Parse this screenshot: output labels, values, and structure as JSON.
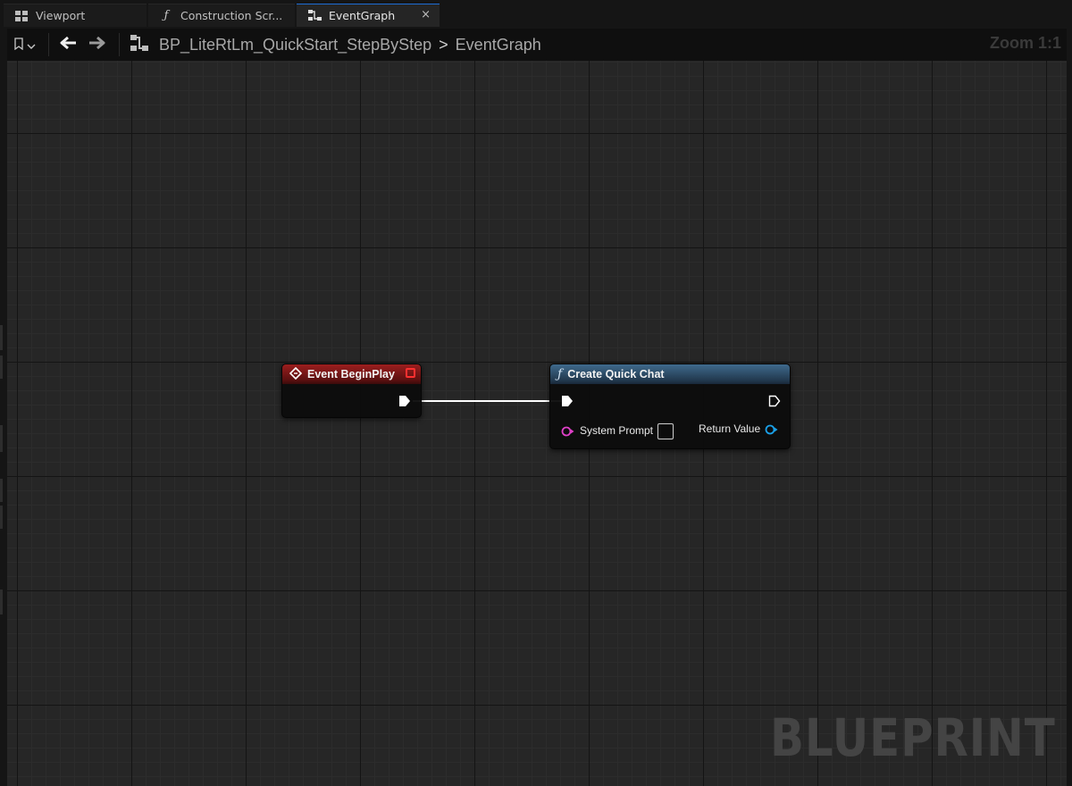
{
  "tabs": [
    {
      "label": "Viewport",
      "icon": "viewport-icon",
      "active": false
    },
    {
      "label": "Construction Scr...",
      "icon": "function-icon",
      "active": false
    },
    {
      "label": "EventGraph",
      "icon": "graph-icon",
      "active": true
    }
  ],
  "close_glyph": "×",
  "toolbar": {
    "blueprint_name": "BP_LiteRtLm_QuickStart_StepByStep",
    "separator_glyph": ">",
    "graph_name": "EventGraph",
    "zoom": "Zoom 1:1"
  },
  "nodes": {
    "event_begin_play": {
      "title": "Event BeginPlay",
      "header_color": "#9c1e1e"
    },
    "create_quick_chat": {
      "title": "Create Quick Chat",
      "header_color": "#3f6a8c",
      "input_label": "System Prompt",
      "output_label": "Return Value"
    }
  },
  "watermark": "BLUEPRINT",
  "colors": {
    "exec_wire": "#ffffff",
    "string_pin": "#e040c8",
    "object_pin": "#1aa0e8",
    "active_tab_accent": "#1d6cd4"
  }
}
